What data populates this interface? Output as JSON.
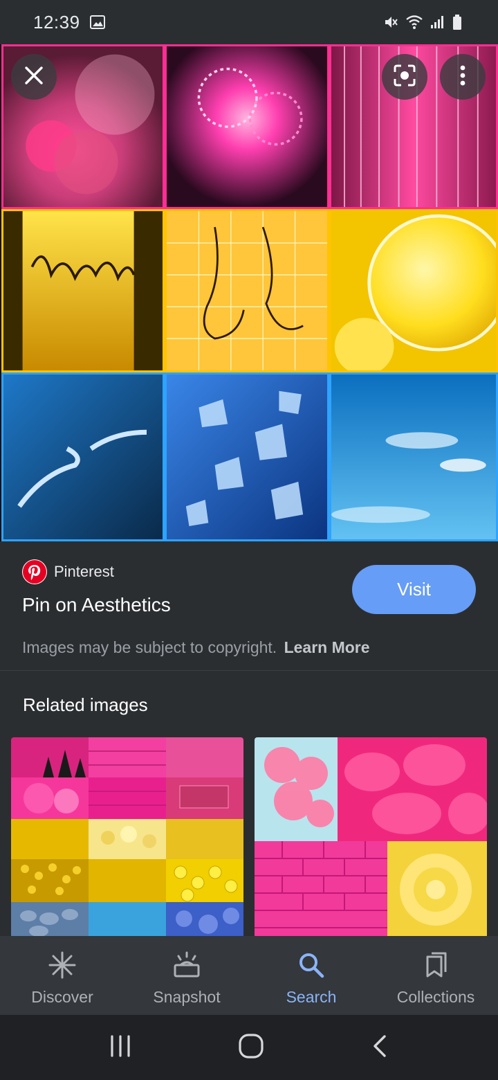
{
  "status_bar": {
    "time": "12:39",
    "icons": [
      "gallery-icon",
      "mute-icon",
      "wifi-icon",
      "signal-icon",
      "battery-icon"
    ]
  },
  "hero": {
    "close_icon": "close-icon",
    "lens_icon": "lens-icon",
    "more_icon": "more-vert-icon"
  },
  "info": {
    "source_name": "Pinterest",
    "title": "Pin on Aesthetics",
    "visit_label": "Visit",
    "copyright_text": "Images may be subject to copyright.",
    "learn_more": "Learn More"
  },
  "related": {
    "heading": "Related images"
  },
  "bottom_nav": {
    "items": [
      {
        "label": "Discover",
        "icon": "asterisk-icon"
      },
      {
        "label": "Snapshot",
        "icon": "snapshot-icon"
      },
      {
        "label": "Search",
        "icon": "search-icon"
      },
      {
        "label": "Collections",
        "icon": "collections-icon"
      }
    ],
    "active": "Search"
  },
  "system_nav": [
    "recents-icon",
    "home-icon",
    "back-icon"
  ],
  "colors": {
    "background": "#2b2e31",
    "accent": "#8ab4f8",
    "visit_button": "#669df6",
    "pink": "#ff2e93",
    "yellow": "#ffc400",
    "blue": "#2ea3ff"
  }
}
